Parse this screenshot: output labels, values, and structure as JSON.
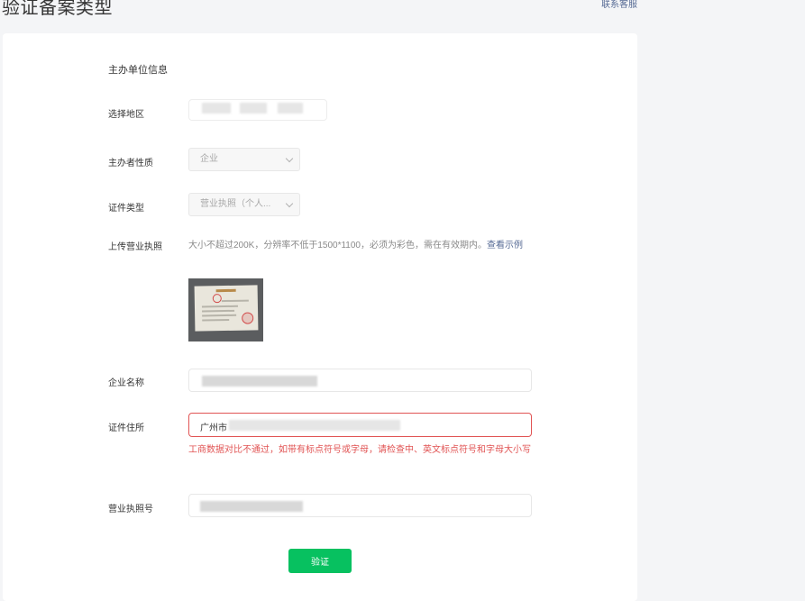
{
  "header": {
    "title": "验证备案类型",
    "contact_link": "联系客服"
  },
  "form": {
    "section_title": "主办单位信息",
    "region": {
      "label": "选择地区"
    },
    "organizer_type": {
      "label": "主办者性质",
      "value": "企业"
    },
    "certificate_type": {
      "label": "证件类型",
      "value": "营业执照（个人..."
    },
    "license_upload": {
      "label": "上传营业执照",
      "hint": "大小不超过200K，分辨率不低于1500*1100，必须为彩色，需在有效期内。",
      "example_link": "查看示例"
    },
    "company_name": {
      "label": "企业名称"
    },
    "certificate_address": {
      "label": "证件住所",
      "value_prefix": "广州市",
      "error": "工商数据对比不通过，如带有标点符号或字母，请检查中、英文标点符号和字母大小写"
    },
    "license_number": {
      "label": "营业执照号"
    },
    "submit_label": "验证"
  },
  "colors": {
    "accent": "#07c160",
    "error": "#e15454",
    "link": "#576b95"
  }
}
